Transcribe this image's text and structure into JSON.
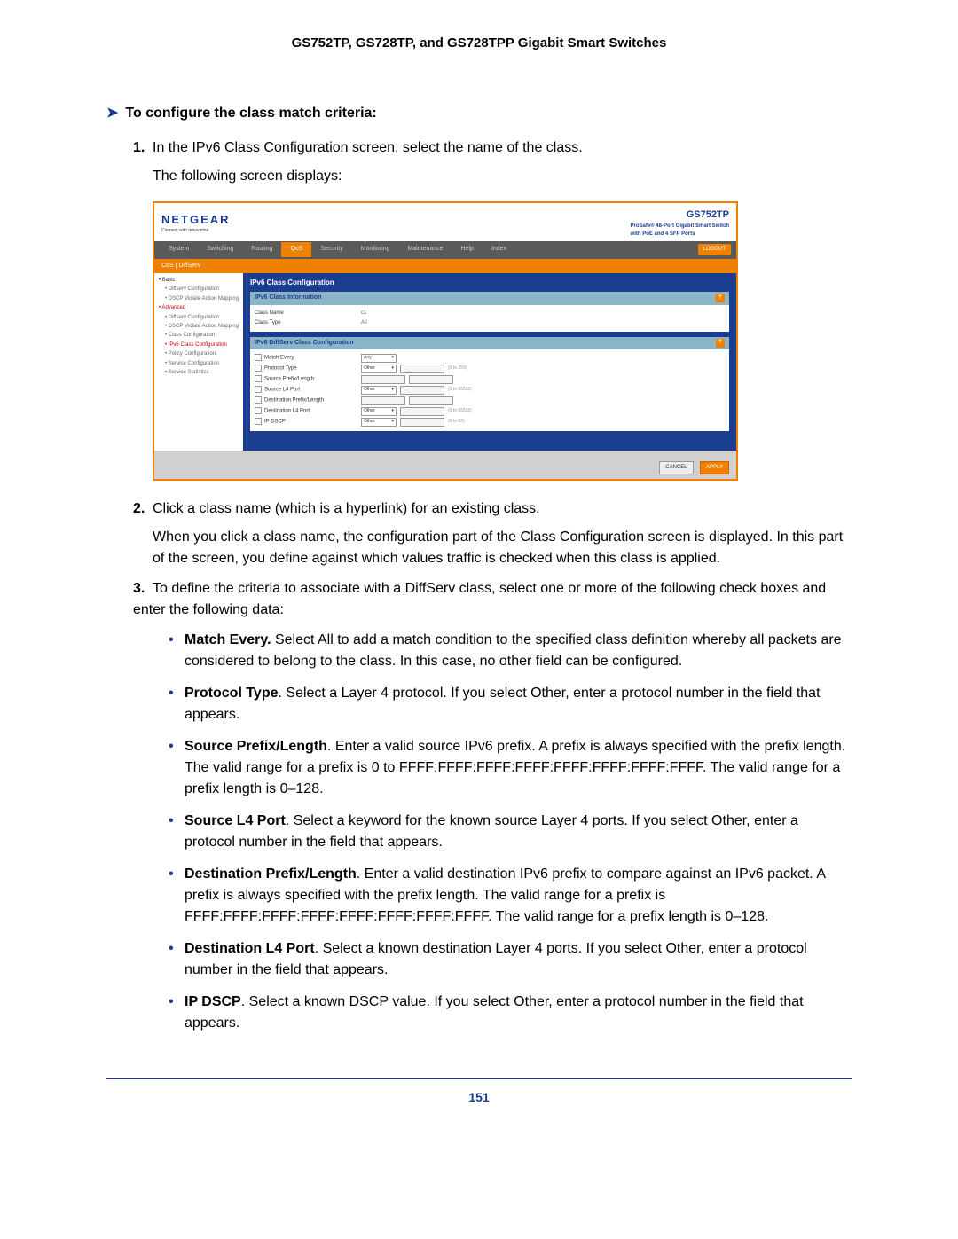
{
  "doc_header": "GS752TP, GS728TP, and GS728TPP Gigabit Smart Switches",
  "procedure_title": "To configure the class match criteria:",
  "steps": {
    "s1": {
      "num": "1.",
      "text": "In the IPv6 Class Configuration screen, select the name of the class.",
      "para1": "The following screen displays:"
    },
    "s2": {
      "num": "2.",
      "text": "Click a class name (which is a hyperlink) for an existing class.",
      "para1": "When you click a class name, the configuration part of the Class Configuration screen is displayed. In this part of the screen, you define against which values traffic is checked when this class is applied."
    },
    "s3": {
      "num": "3.",
      "text": "To define the criteria to associate with a DiffServ class, select one or more of the following check boxes and enter the following data:"
    }
  },
  "bullets": {
    "b1": {
      "bold": "Match Every.",
      "text": " Select All to add a match condition to the specified class definition whereby all packets are considered to belong to the class. In this case, no other field can be configured."
    },
    "b2": {
      "bold": "Protocol Type",
      "text": ". Select a Layer 4 protocol. If you select Other, enter a protocol number in the field that appears."
    },
    "b3": {
      "bold": "Source Prefix/Length",
      "text": ". Enter a valid source IPv6 prefix. A prefix is always specified with the prefix length. The valid range for a prefix is 0 to FFFF:FFFF:FFFF:FFFF:FFFF:FFFF:FFFF:FFFF. The valid range for a prefix length is 0–128."
    },
    "b4": {
      "bold": "Source L4 Port",
      "text": ". Select a keyword for the known source Layer 4 ports. If you select Other, enter a protocol number in the field that appears."
    },
    "b5": {
      "bold": "Destination Prefix/Length",
      "text": ". Enter a valid destination IPv6 prefix to compare against an IPv6 packet. A prefix is always specified with the prefix length. The valid range for a prefix is FFFF:FFFF:FFFF:FFFF:FFFF:FFFF:FFFF:FFFF. The valid range for a prefix length is 0–128."
    },
    "b6": {
      "bold": "Destination L4 Port",
      "text": ". Select a known destination Layer 4 ports. If you select Other, enter a protocol number in the field that appears."
    },
    "b7": {
      "bold": "IP DSCP",
      "text": ". Select a known DSCP value. If you select Other, enter a protocol number in the field that appears."
    }
  },
  "screenshot": {
    "logo": "NETGEAR",
    "logo_sub": "Connect with Innovation",
    "model": "GS752TP",
    "model_sub1": "ProSafe® 48-Port Gigabit Smart Switch",
    "model_sub2": "with PoE and 4 SFP Ports",
    "tabs": [
      "System",
      "Switching",
      "Routing",
      "QoS",
      "Security",
      "Monitoring",
      "Maintenance",
      "Help",
      "Index"
    ],
    "active_tab": "QoS",
    "logout": "LOGOUT",
    "subtabs": "CoS  |  DiffServ",
    "sidebar": {
      "basic": "• Basic",
      "diffserv_cfg": "• Diffserv Configuration",
      "dscp_violate": "• DSCP Violate Action Mapping",
      "advanced": "• Advanced",
      "diffserv_cfg2": "• Diffserv Configuration",
      "dscp_violate2": "• DSCP Violate Action Mapping",
      "class_cfg": "• Class Configuration",
      "ipv6_class_cfg": "• IPv6 Class Configuration",
      "policy_cfg": "• Policy Configuration",
      "service_cfg": "• Service Configuration",
      "service_stats": "• Service Statistics"
    },
    "content_title": "IPv6 Class Configuration",
    "panel1": {
      "title": "IPv6 Class Information",
      "class_name_lbl": "Class Name",
      "class_name_val": "c1",
      "class_type_lbl": "Class Type",
      "class_type_val": "All"
    },
    "panel2": {
      "title": "IPv6 DiffServ Class Configuration",
      "match_every": "Match Every",
      "match_every_val": "Any",
      "protocol_type": "Protocol Type",
      "protocol_type_val": "Other",
      "protocol_type_hint": "(0 to 255)",
      "src_prefix": "Source Prefix/Length",
      "src_l4": "Source L4 Port",
      "src_l4_val": "Other",
      "src_l4_hint": "(0 to 65535)",
      "dst_prefix": "Destination Prefix/Length",
      "dst_l4": "Destination L4 Port",
      "dst_l4_val": "Other",
      "dst_l4_hint": "(0 to 65535)",
      "ip_dscp": "IP DSCP",
      "ip_dscp_val": "Other",
      "ip_dscp_hint": "(0 to 63)"
    },
    "footer": {
      "cancel": "CANCEL",
      "apply": "APPLY"
    }
  },
  "page_number": "151"
}
